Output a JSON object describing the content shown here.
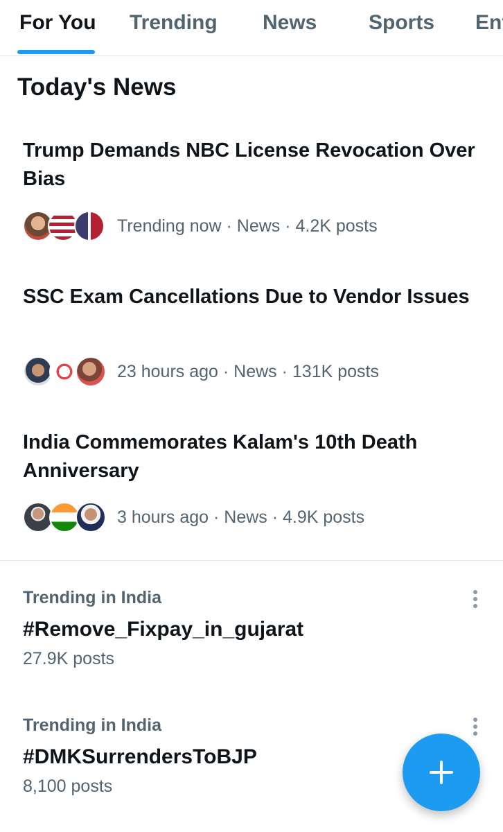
{
  "tabs": [
    {
      "label": "For You",
      "active": true
    },
    {
      "label": "Trending",
      "active": false
    },
    {
      "label": "News",
      "active": false
    },
    {
      "label": "Sports",
      "active": false
    },
    {
      "label": "Ent",
      "active": false
    }
  ],
  "section_title": "Today's News",
  "news": [
    {
      "headline": "Trump Demands NBC License Revocation Over Bias",
      "meta": "Trending now · News · 4.2K posts"
    },
    {
      "headline": "SSC Exam Cancellations Due to Vendor Issues",
      "meta": "23 hours ago · News · 131K posts"
    },
    {
      "headline": "India Commemorates Kalam's 10th Death Anniversary",
      "meta": "3 hours ago · News · 4.9K posts"
    }
  ],
  "trends": [
    {
      "context": "Trending in India",
      "name": "#Remove_Fixpay_in_gujarat",
      "count": "27.9K posts"
    },
    {
      "context": "Trending in India",
      "name": "#DMKSurrendersToBJP",
      "count": "8,100 posts"
    }
  ],
  "icons": {
    "compose": "plus-icon",
    "more": "more-vertical-icon"
  },
  "colors": {
    "accent": "#1d9bf0",
    "secondary_text": "#536471",
    "primary_text": "#0f1419"
  }
}
